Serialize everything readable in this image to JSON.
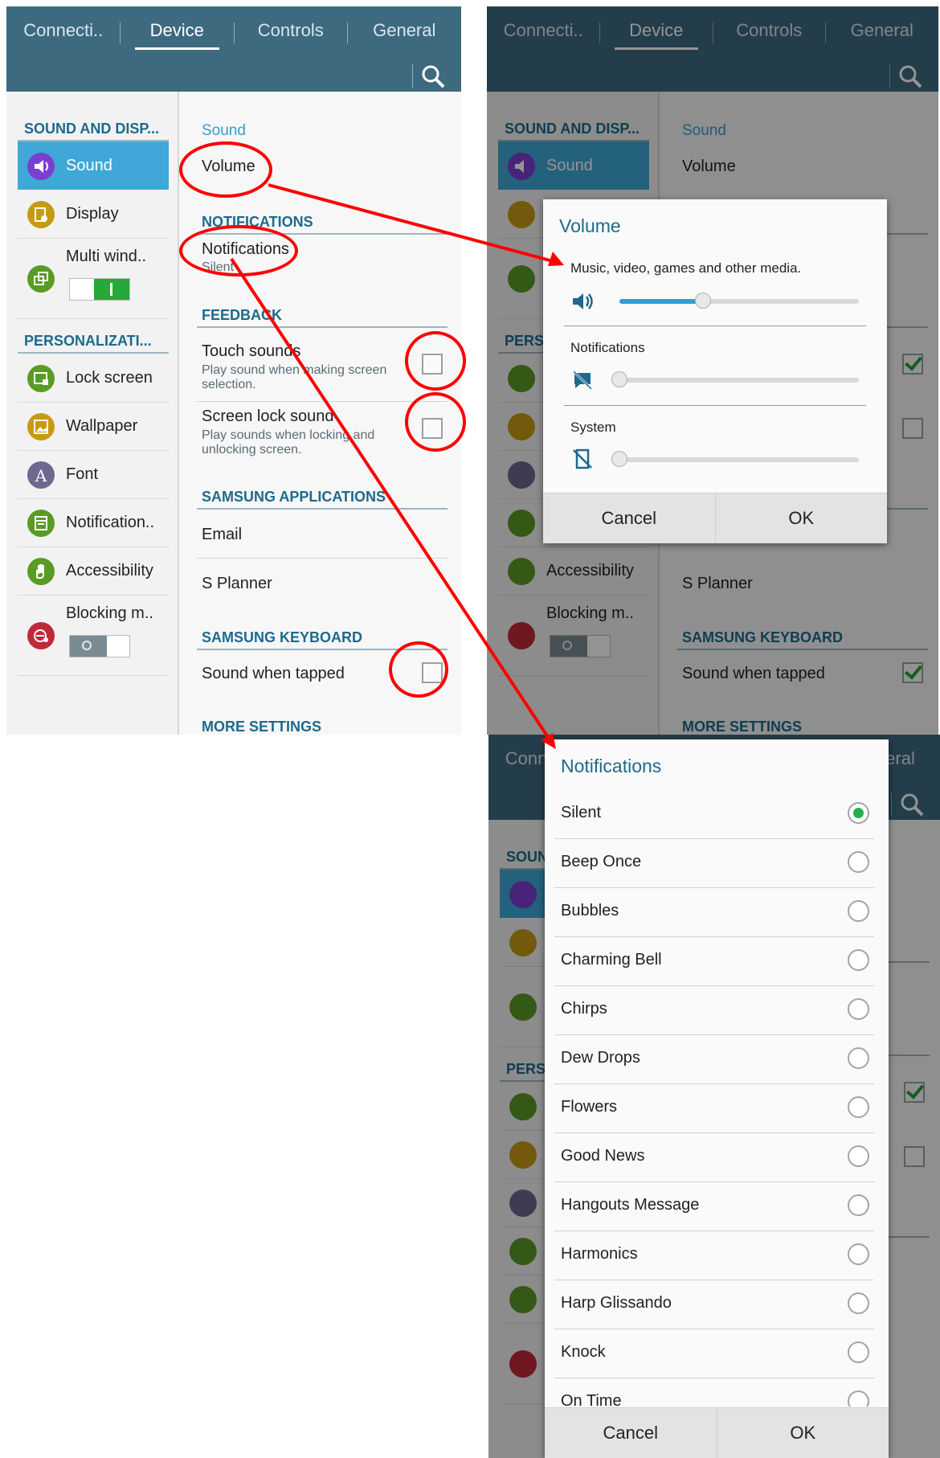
{
  "tabs": [
    "Connecti..",
    "Device",
    "Controls",
    "General"
  ],
  "left_sections": {
    "sound_display": "SOUND AND DISP...",
    "personalization": "PERSONALIZATI..."
  },
  "menu": [
    {
      "label": "Sound",
      "icon": "speaker-icon",
      "color": "#7b3fd0"
    },
    {
      "label": "Display",
      "icon": "display-icon",
      "color": "#c79a14"
    },
    {
      "label": "Multi wind..",
      "icon": "multi-window-icon",
      "color": "#5a9a26"
    },
    {
      "label": "Lock screen",
      "icon": "lock-screen-icon",
      "color": "#5a9a26"
    },
    {
      "label": "Wallpaper",
      "icon": "wallpaper-icon",
      "color": "#c79a14"
    },
    {
      "label": "Font",
      "icon": "font-icon",
      "color": "#6c6890"
    },
    {
      "label": "Notification..",
      "icon": "notification-panel-icon",
      "color": "#5a9a26"
    },
    {
      "label": "Accessibility",
      "icon": "hand-icon",
      "color": "#5a9a26"
    },
    {
      "label": "Blocking m..",
      "icon": "blocking-icon",
      "color": "#c0283a"
    }
  ],
  "right": {
    "sound_header": "Sound",
    "volume": "Volume",
    "notifications_section": "NOTIFICATIONS",
    "notifications": "Notifications",
    "notifications_value": "Silent",
    "feedback_section": "FEEDBACK",
    "touch_sounds": "Touch sounds",
    "touch_sounds_sub": "Play sound when making screen selection.",
    "screen_lock_sound": "Screen lock sound",
    "screen_lock_sound_sub": "Play sounds when locking and unlocking screen.",
    "samsung_apps_section": "SAMSUNG APPLICATIONS",
    "email": "Email",
    "s_planner": "S Planner",
    "keyboard_section": "SAMSUNG KEYBOARD",
    "sound_when_tapped": "Sound when tapped",
    "more_settings": "MORE SETTINGS"
  },
  "volume_dialog": {
    "title": "Volume",
    "media_label": "Music, video, games and other media.",
    "media_level": 0.35,
    "notifications_label": "Notifications",
    "notifications_level": 0.0,
    "system_label": "System",
    "system_level": 0.0,
    "cancel": "Cancel",
    "ok": "OK"
  },
  "notifications_dialog": {
    "title": "Notifications",
    "options": [
      "Silent",
      "Beep Once",
      "Bubbles",
      "Charming Bell",
      "Chirps",
      "Dew Drops",
      "Flowers",
      "Good News",
      "Hangouts Message",
      "Harmonics",
      "Harp Glissando",
      "Knock",
      "On Time"
    ],
    "selected": "Silent",
    "cancel": "Cancel",
    "ok": "OK"
  },
  "colors": {
    "header": "#3e6a80",
    "accent": "#1d6a8c",
    "selected": "#3fa8d8",
    "annotation": "#ff0000"
  }
}
